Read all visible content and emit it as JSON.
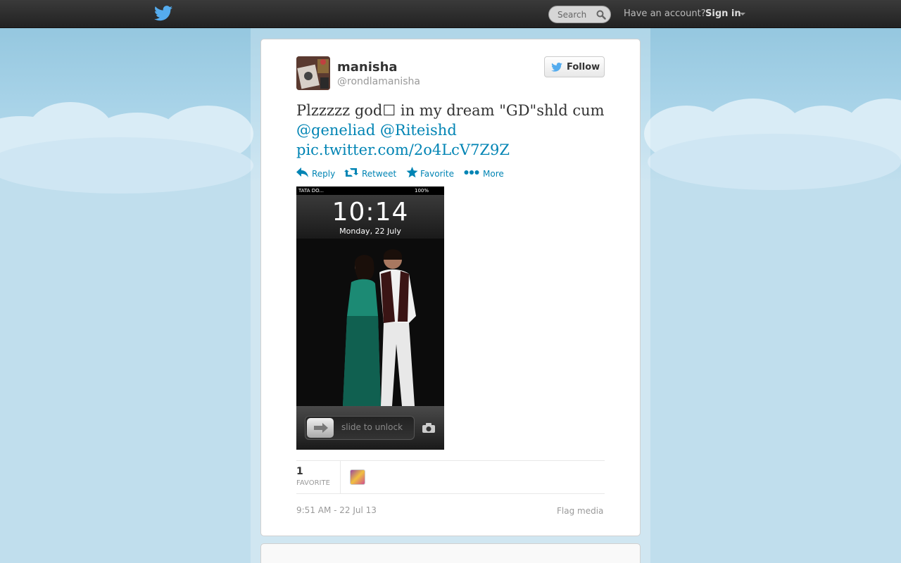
{
  "topbar": {
    "logo_icon": "twitter-bird-icon",
    "search": {
      "placeholder": "Search",
      "icon": "search-icon"
    },
    "have_account": "Have an account?",
    "signin": "Sign in"
  },
  "tweet": {
    "name": "manisha",
    "handle": "@rondlamanisha",
    "follow_label": "Follow",
    "text_before": "Plzzzzz god☐ in my dream \"GD\"shld cum",
    "mentions": [
      "@geneliad",
      "@Riteishd"
    ],
    "link": "pic.twitter.com/2o4LcV7Z9Z",
    "actions": {
      "reply": "Reply",
      "retweet": "Retweet",
      "favorite": "Favorite",
      "more": "More"
    },
    "photo": {
      "carrier": "TATA DO...",
      "battery": "100%",
      "time": "10:14",
      "date": "Monday, 22 July",
      "slide": "slide to unlock"
    },
    "favorites_count": "1",
    "favorites_label": "FAVORITE",
    "timestamp": "9:51 AM - 22 Jul 13",
    "flag": "Flag media"
  },
  "colors": {
    "link": "#0084b4",
    "sky": "#c0deed",
    "topbar": "#2b2b2b"
  }
}
